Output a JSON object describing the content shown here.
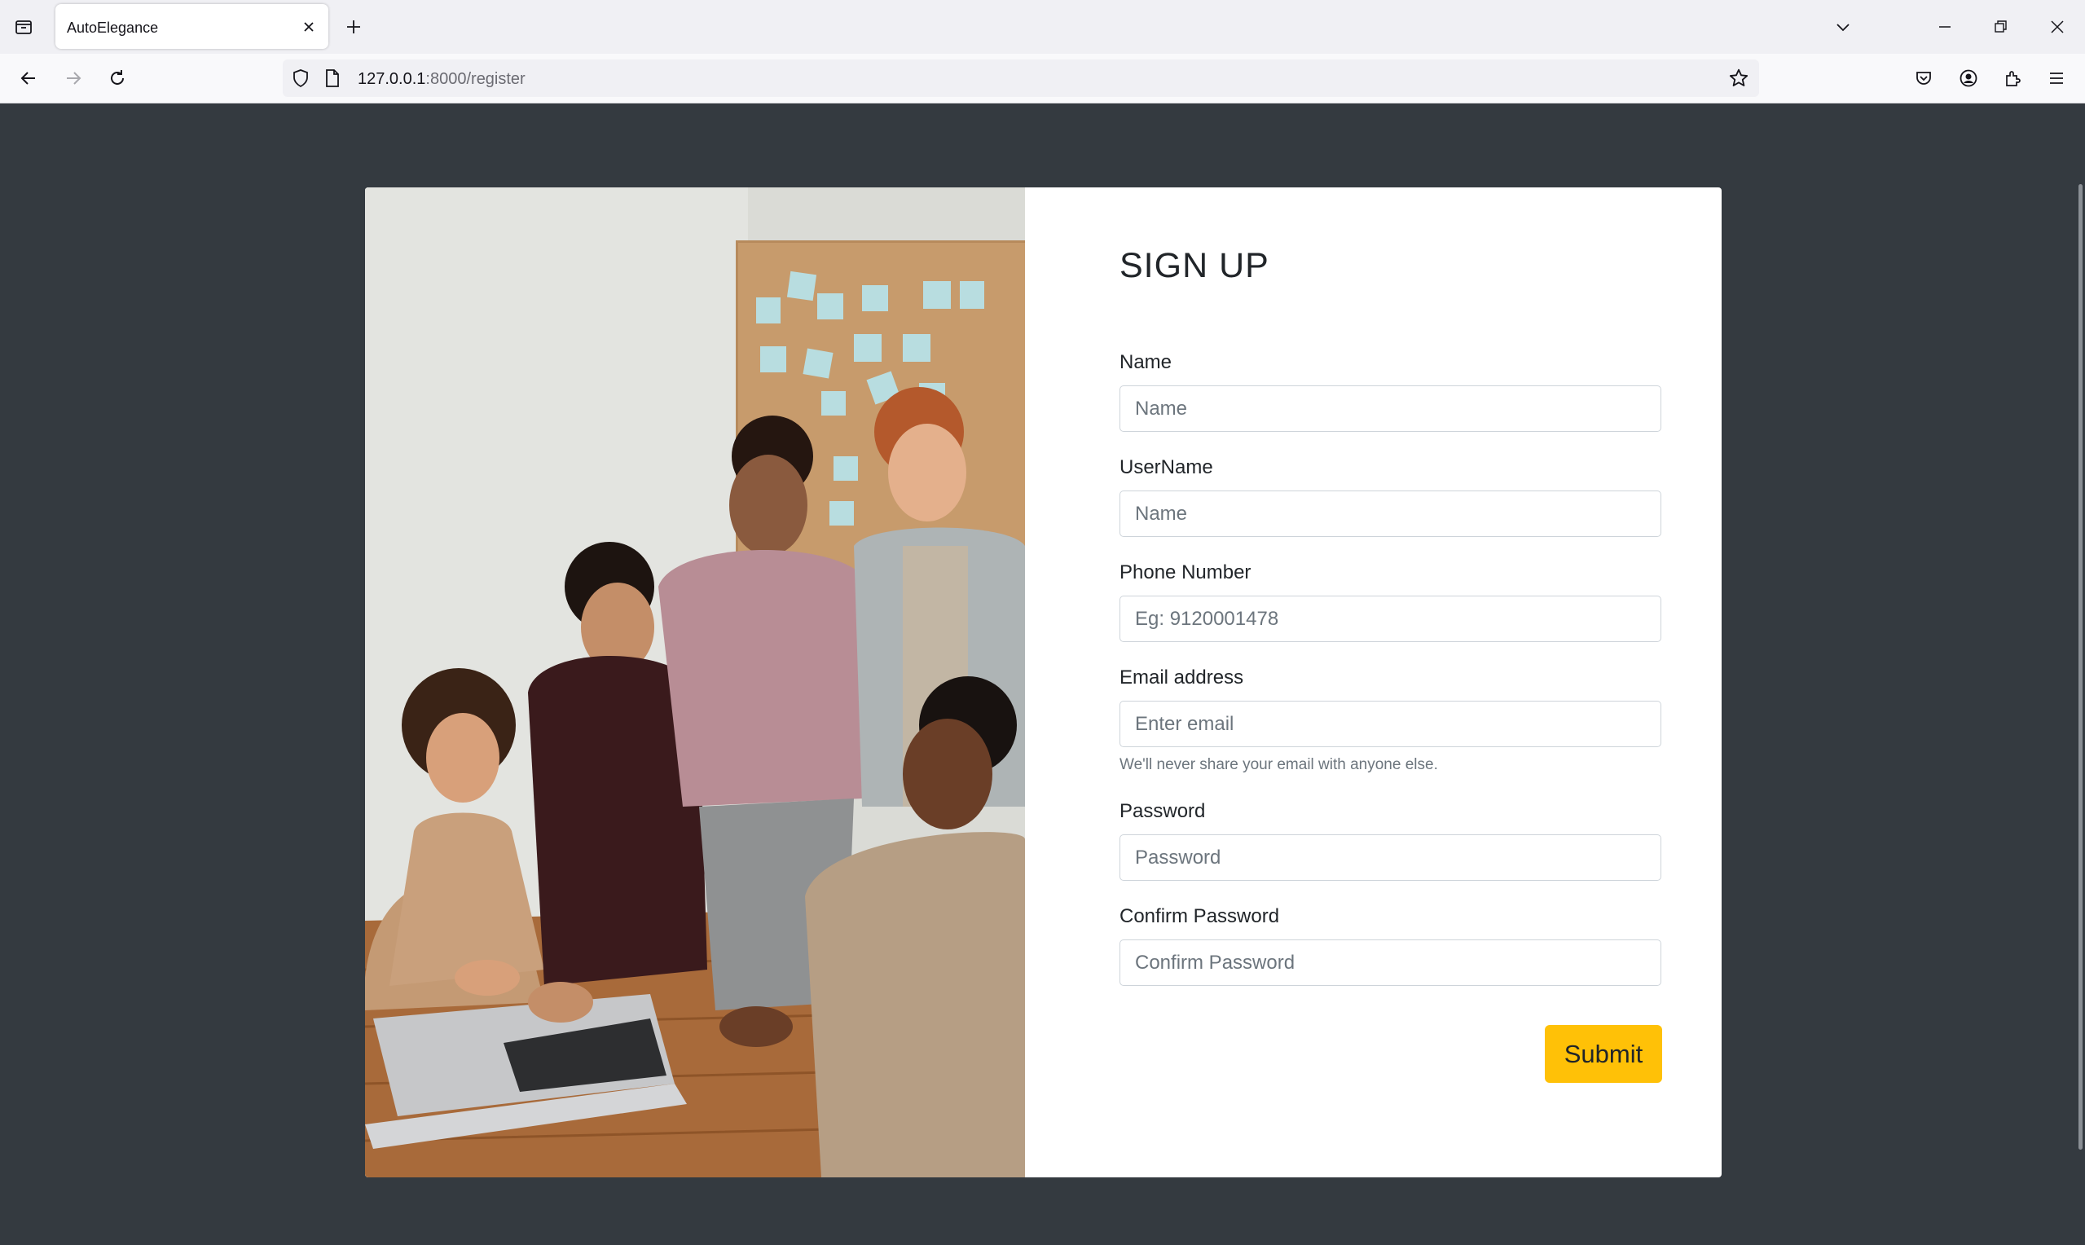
{
  "browser": {
    "tab_title": "AutoElegance",
    "url_host": "127.0.0.1",
    "url_path": ":8000/register"
  },
  "form": {
    "heading": "SIGN UP",
    "fields": [
      {
        "label": "Name",
        "placeholder": "Name"
      },
      {
        "label": "UserName",
        "placeholder": "Name"
      },
      {
        "label": "Phone Number",
        "placeholder": "Eg: 9120001478"
      },
      {
        "label": "Email address",
        "placeholder": "Enter email"
      },
      {
        "label": "Password",
        "placeholder": "Password"
      },
      {
        "label": "Confirm Password",
        "placeholder": "Confirm Password"
      }
    ],
    "email_help": "We'll never share your email with anyone else.",
    "submit_label": "Submit"
  },
  "colors": {
    "page_bg": "#343a40",
    "card_bg": "#ffffff",
    "submit_bg": "#ffc107"
  }
}
